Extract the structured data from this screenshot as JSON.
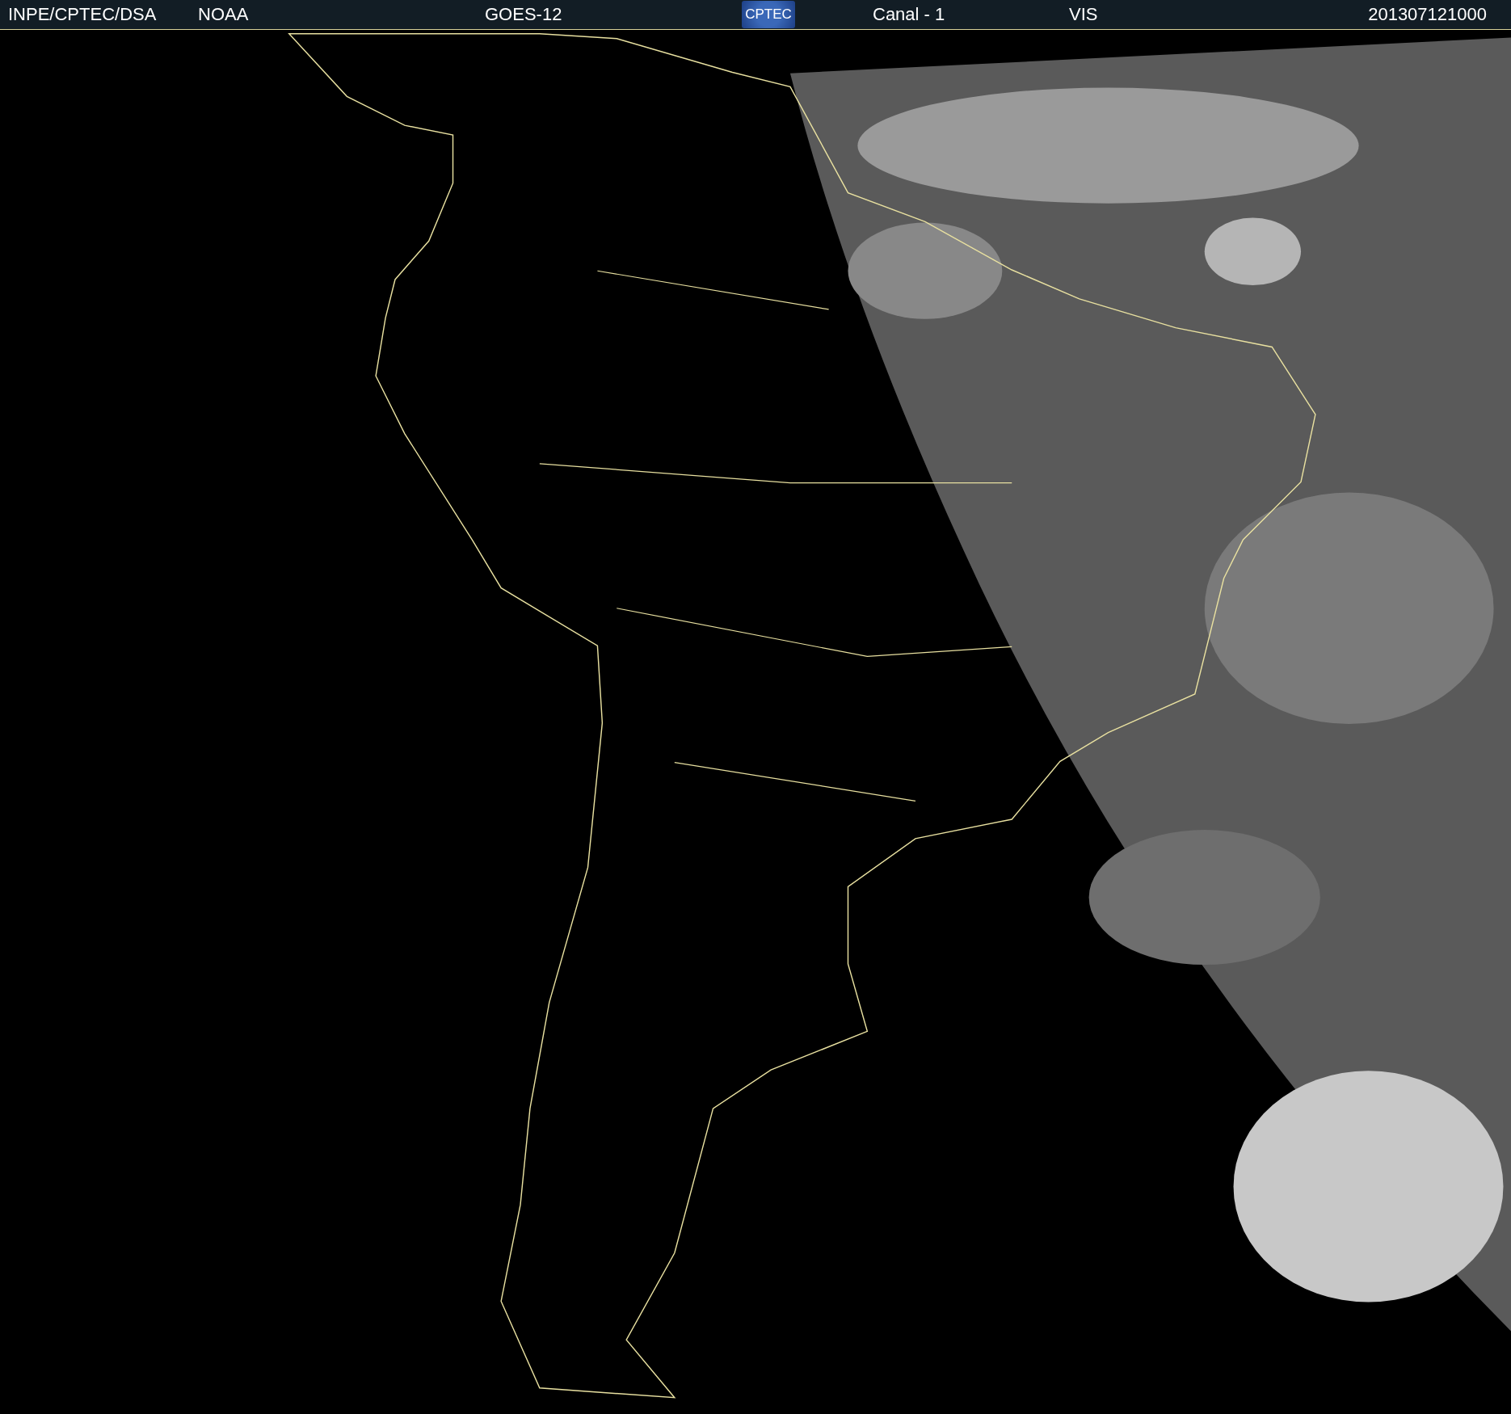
{
  "header": {
    "source": "INPE/CPTEC/DSA",
    "agency": "NOAA",
    "satellite": "GOES-12",
    "logo_text": "CPTEC",
    "channel": "Canal - 1",
    "band": "VIS",
    "timestamp": "201307121000"
  }
}
